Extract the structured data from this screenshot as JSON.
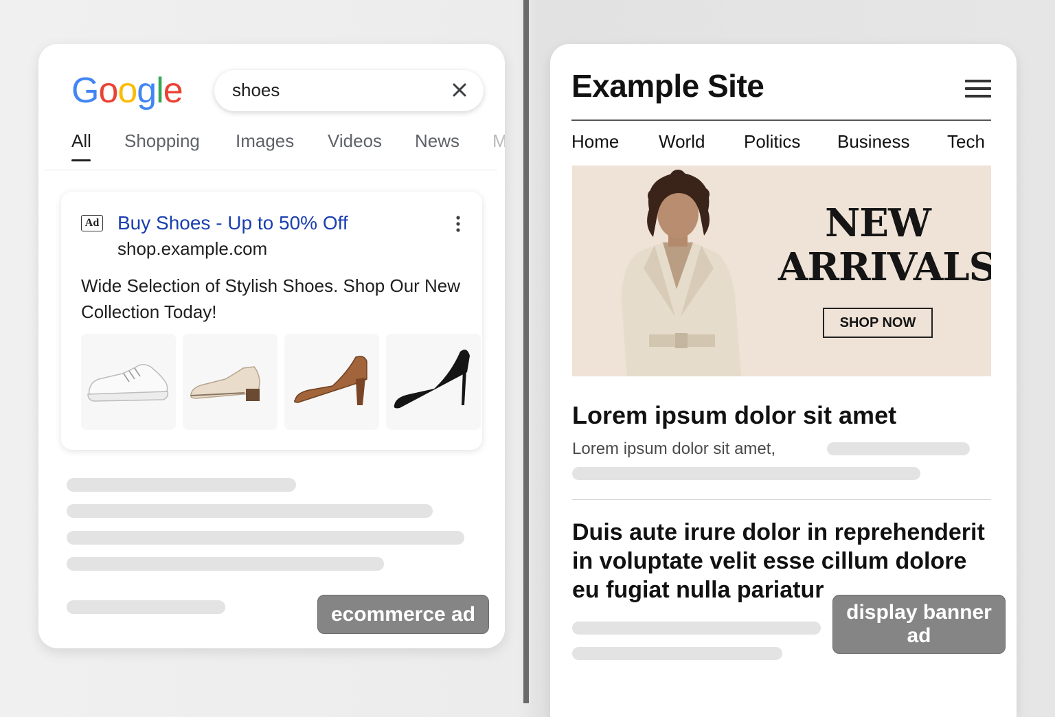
{
  "search": {
    "logo": "Google",
    "query": "shoes",
    "tabs": [
      {
        "label": "All",
        "active": true
      },
      {
        "label": "Shopping"
      },
      {
        "label": "Images"
      },
      {
        "label": "Videos"
      },
      {
        "label": "News"
      },
      {
        "label": "M"
      }
    ]
  },
  "ad": {
    "badge": "Ad",
    "title": "Buy Shoes - Up to 50% Off",
    "url": "shop.example.com",
    "description": "Wide Selection of Stylish Shoes. Shop Our New Collection Today!",
    "products": [
      "white-sneaker",
      "cream-loafer",
      "brown-heel",
      "black-stiletto"
    ]
  },
  "labels": {
    "left": "ecommerce ad",
    "right": "display banner ad"
  },
  "site": {
    "title": "Example Site",
    "nav": [
      "Home",
      "World",
      "Politics",
      "Business",
      "Tech"
    ],
    "banner": {
      "headline": "NEW ARRIVALS",
      "cta": "SHOP NOW"
    },
    "article1": {
      "title": "Lorem ipsum dolor sit amet",
      "subtitle": "Lorem ipsum dolor sit amet,"
    },
    "article2": {
      "title": "Duis aute irure dolor in reprehenderit in voluptate velit esse cillum dolore eu fugiat nulla pariatur"
    }
  },
  "colors": {
    "ad_title": "#1a3fb0",
    "banner_bg": "#efe2d6",
    "label_pill": "#858585",
    "google_blue": "#4285f4",
    "google_red": "#ea4335",
    "google_yellow": "#fbbc05",
    "google_green": "#34a853"
  }
}
